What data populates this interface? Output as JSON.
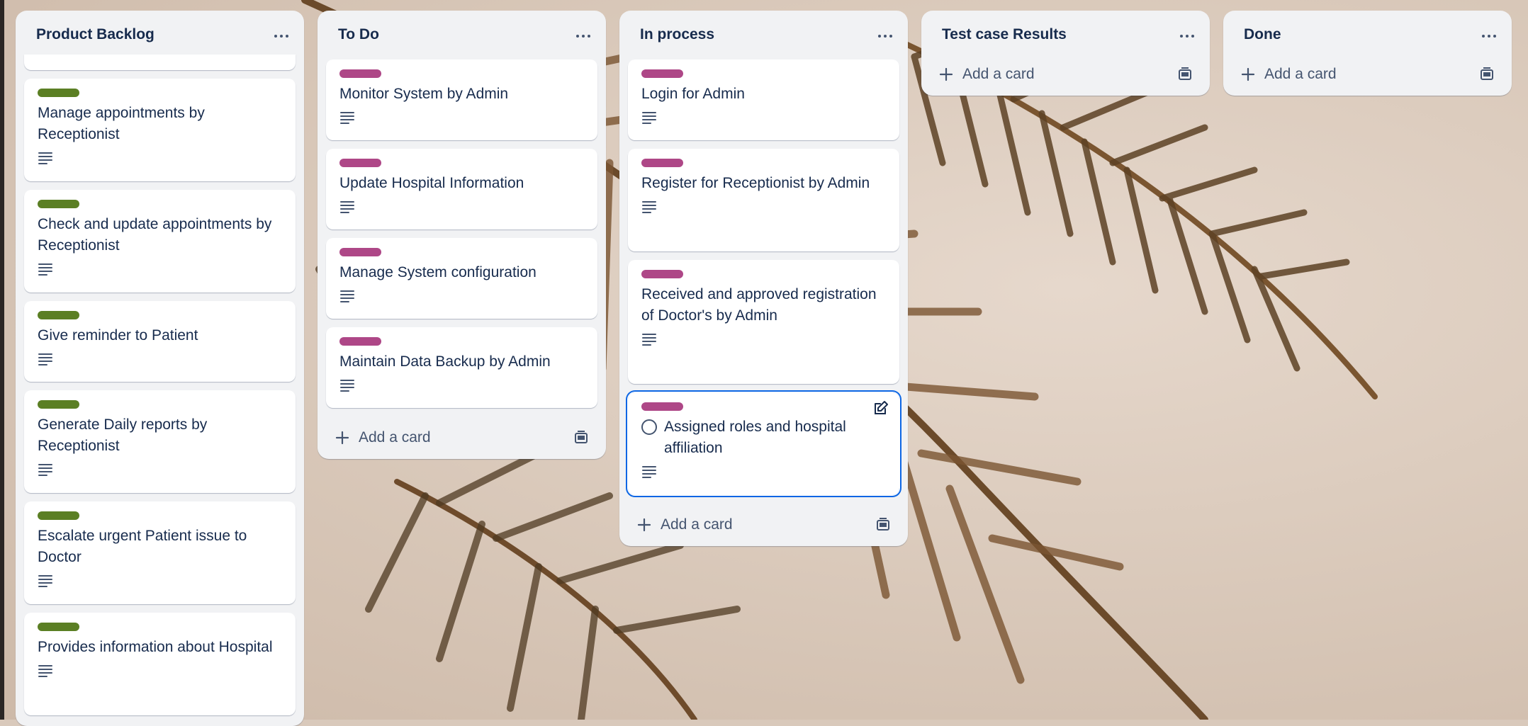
{
  "colors": {
    "label_pink": "#ae4787",
    "label_green": "#5b7f24",
    "active_outline": "#0c66e4",
    "list_bg": "#f1f2f4",
    "text": "#172b4d"
  },
  "lists": [
    {
      "title": "Product Backlog",
      "menu_icon": "ellipsis-icon",
      "cards": [
        {
          "label_color": "green",
          "title": "Manage appointments by Receptionist",
          "icon": "description-icon"
        },
        {
          "label_color": "green",
          "title": "Check and update appointments by Receptionist",
          "icon": "description-icon"
        },
        {
          "label_color": "green",
          "title": "Give reminder to Patient",
          "icon": "description-icon"
        },
        {
          "label_color": "green",
          "title": "Generate Daily reports by Receptionist",
          "icon": "description-icon"
        },
        {
          "label_color": "green",
          "title": "Escalate urgent Patient issue to Doctor",
          "icon": "description-icon"
        },
        {
          "label_color": "green",
          "title": "Provides information about Hospital",
          "icon": "description-icon"
        }
      ]
    },
    {
      "title": "To Do",
      "menu_icon": "ellipsis-icon",
      "cards": [
        {
          "label_color": "pink",
          "title": "Monitor System by Admin",
          "icon": "description-icon"
        },
        {
          "label_color": "pink",
          "title": "Update Hospital Information",
          "icon": "description-icon"
        },
        {
          "label_color": "pink",
          "title": "Manage System configuration",
          "icon": "description-icon"
        },
        {
          "label_color": "pink",
          "title": "Maintain Data Backup by Admin",
          "icon": "description-icon"
        }
      ],
      "add_card": "Add a card"
    },
    {
      "title": "In process",
      "menu_icon": "ellipsis-icon",
      "cards": [
        {
          "label_color": "pink",
          "title": "Login for Admin",
          "icon": "description-icon"
        },
        {
          "label_color": "pink",
          "title": "Register for Receptionist by Admin",
          "icon": "description-icon"
        },
        {
          "label_color": "pink",
          "title": "Received and approved registration of Doctor's by Admin",
          "icon": "description-icon"
        },
        {
          "label_color": "pink",
          "title": "Assigned roles and hospital affiliation",
          "icon": "description-icon",
          "active": true
        }
      ],
      "add_card": "Add a card"
    },
    {
      "title": "Test case Results",
      "menu_icon": "ellipsis-icon",
      "cards": [],
      "add_card": "Add a card"
    },
    {
      "title": "Done",
      "menu_icon": "ellipsis-icon",
      "cards": [],
      "add_card": "Add a card"
    }
  ]
}
